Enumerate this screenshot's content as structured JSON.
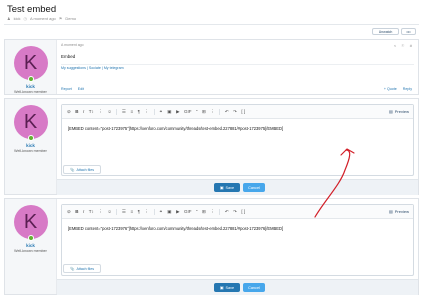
{
  "thread": {
    "title": "Test embed",
    "meta_author": "kick",
    "meta_time": "A moment ago",
    "meta_extra": "Demo"
  },
  "topbar": {
    "unwatch_label": "Unwatch",
    "more_label": "•••"
  },
  "post": {
    "author": "kick",
    "user_title": "Well-known member",
    "avatar_letter": "K",
    "time": "A moment ago",
    "body": "Embed",
    "signature": "My suggestions | Sociate | My telegram",
    "report": "Report",
    "edit": "Edit",
    "quote": "+ Quote",
    "reply": "Reply"
  },
  "editors": [
    {
      "author": "kick",
      "user_title": "Well-known member",
      "avatar_letter": "K",
      "content": "[EMBED content=\"post-1723975\"]https://xenforo.com/community/threads/test-embed.227881/#post-1723975[/EMBED]",
      "preview_label": "Preview",
      "attach_label": "Attach files",
      "save_label": "Save",
      "cancel_label": "Cancel"
    },
    {
      "author": "kick",
      "user_title": "Well-known member",
      "avatar_letter": "K",
      "content": "[EMBED content=\"post-1723976\"]https://xenforo.com/community/threads/test-embed.227881/#post-1723976[/EMBED]",
      "preview_label": "Preview",
      "attach_label": "Attach files",
      "save_label": "Save",
      "cancel_label": "Cancel"
    }
  ],
  "colors": {
    "accent": "#2577b1",
    "annotation": "#d21f28",
    "avatar": "#d77ac6"
  }
}
